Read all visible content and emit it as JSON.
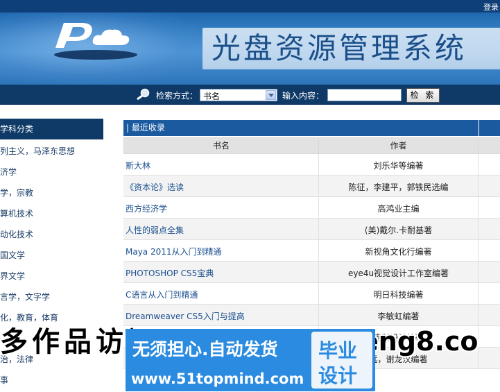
{
  "header": {
    "login_label": "登录",
    "system_title": "光盘资源管理系统"
  },
  "search": {
    "method_label": "检索方式：",
    "method_selected": "书名",
    "input_label": "输入内容：",
    "input_value": "",
    "button_label": "检 索"
  },
  "sidebar": {
    "header": "学科分类",
    "items": [
      "列主义，马泽东思想",
      "济学",
      "学，宗教",
      "算机技术",
      "动化技术",
      "国文学",
      "界文学",
      "言学，文字学",
      "化，教育，体育",
      "",
      "治，法律",
      "事"
    ]
  },
  "main": {
    "section_title": "| 最近收录",
    "columns": [
      "书名",
      "作者"
    ],
    "rows": [
      {
        "title": "斯大林",
        "author": "刘乐华等编著"
      },
      {
        "title": "《资本论》选读",
        "author": "陈征，李建平，郭铁民选编"
      },
      {
        "title": "西方经济学",
        "author": "高鸿业主编"
      },
      {
        "title": "人性的弱点全集",
        "author": "(美)戴尔.卡耐基著"
      },
      {
        "title": "Maya 2011从入门到精通",
        "author": "新视角文化行编著"
      },
      {
        "title": "PHOTOSHOP CS5宝典",
        "author": "eye4u视觉设计工作室编著"
      },
      {
        "title": "C语言从入门到精通",
        "author": "明日科技编著"
      },
      {
        "title": "Dreamweaver CS5入门与提高",
        "author": "李敏虹编著"
      },
      {
        "title": "",
        "author": "睿科设计编著"
      },
      {
        "title": "",
        "author": "远，谢龙汉编著"
      }
    ]
  },
  "watermark": {
    "left_text": "多作品访问",
    "right_text": "eng8.co",
    "line1": "无须担心.自动发货",
    "line2": "www.51topmind.com",
    "badge_top": "毕业",
    "badge_bottom": "设计"
  }
}
